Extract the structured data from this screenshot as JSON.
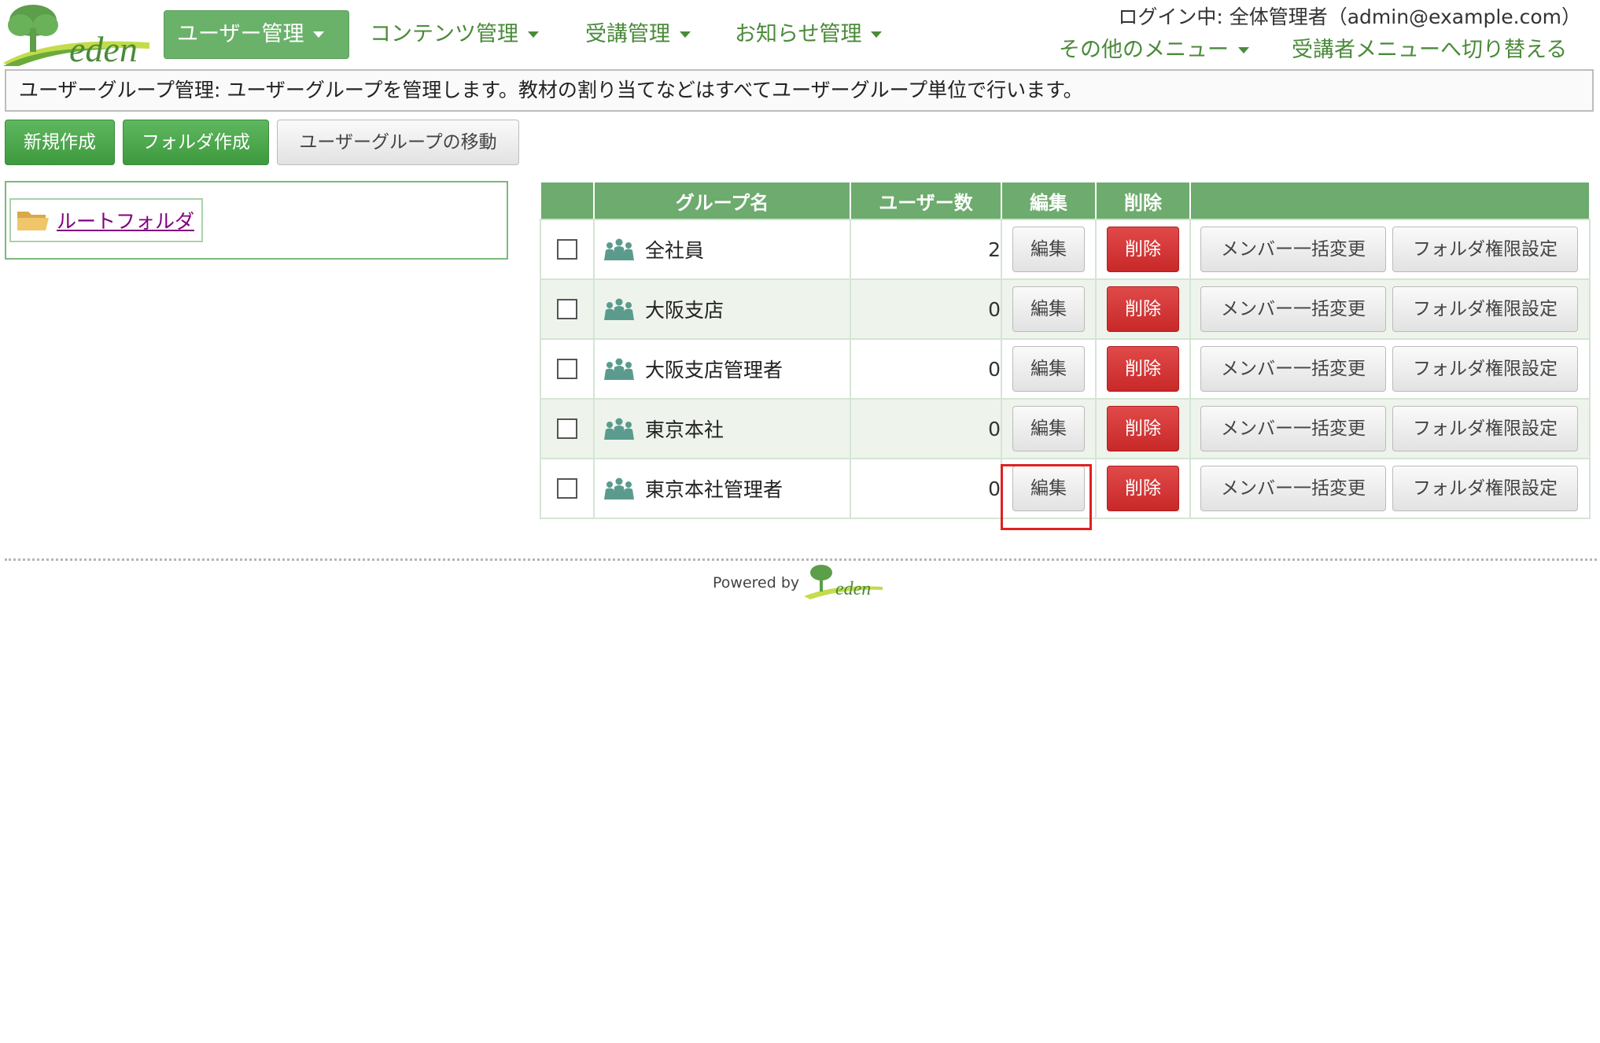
{
  "brand": {
    "logo_text": "eden",
    "accent": "#6eab6e",
    "brand_green": "#4a8a3a"
  },
  "nav": {
    "items": [
      {
        "label": "ユーザー管理",
        "active": true
      },
      {
        "label": "コンテンツ管理",
        "active": false
      },
      {
        "label": "受講管理",
        "active": false
      },
      {
        "label": "お知らせ管理",
        "active": false
      }
    ],
    "login_text": "ログイン中: 全体管理者（admin@example.com）",
    "other_menu": "その他のメニュー",
    "switch_menu": "受講者メニューへ切り替える"
  },
  "info": "ユーザーグループ管理: ユーザーグループを管理します。教材の割り当てなどはすべてユーザーグループ単位で行います。",
  "toolbar": {
    "new_label": "新規作成",
    "folder_label": "フォルダ作成",
    "move_label": "ユーザーグループの移動"
  },
  "folders": {
    "root_label": "ルートフォルダ",
    "icon": "folder-icon"
  },
  "table": {
    "headers": {
      "group_name": "グループ名",
      "user_count": "ユーザー数",
      "edit": "編集",
      "delete": "削除"
    },
    "rows": [
      {
        "name": "全社員",
        "count": "2",
        "edit": "編集",
        "delete": "削除",
        "bulk": "メンバー一括変更",
        "perm": "フォルダ権限設定"
      },
      {
        "name": "大阪支店",
        "count": "0",
        "edit": "編集",
        "delete": "削除",
        "bulk": "メンバー一括変更",
        "perm": "フォルダ権限設定"
      },
      {
        "name": "大阪支店管理者",
        "count": "0",
        "edit": "編集",
        "delete": "削除",
        "bulk": "メンバー一括変更",
        "perm": "フォルダ権限設定"
      },
      {
        "name": "東京本社",
        "count": "0",
        "edit": "編集",
        "delete": "削除",
        "bulk": "メンバー一括変更",
        "perm": "フォルダ権限設定"
      },
      {
        "name": "東京本社管理者",
        "count": "0",
        "edit": "編集",
        "delete": "削除",
        "bulk": "メンバー一括変更",
        "perm": "フォルダ権限設定"
      }
    ]
  },
  "footer": {
    "powered_by": "Powered by",
    "logo_text": "eden"
  }
}
